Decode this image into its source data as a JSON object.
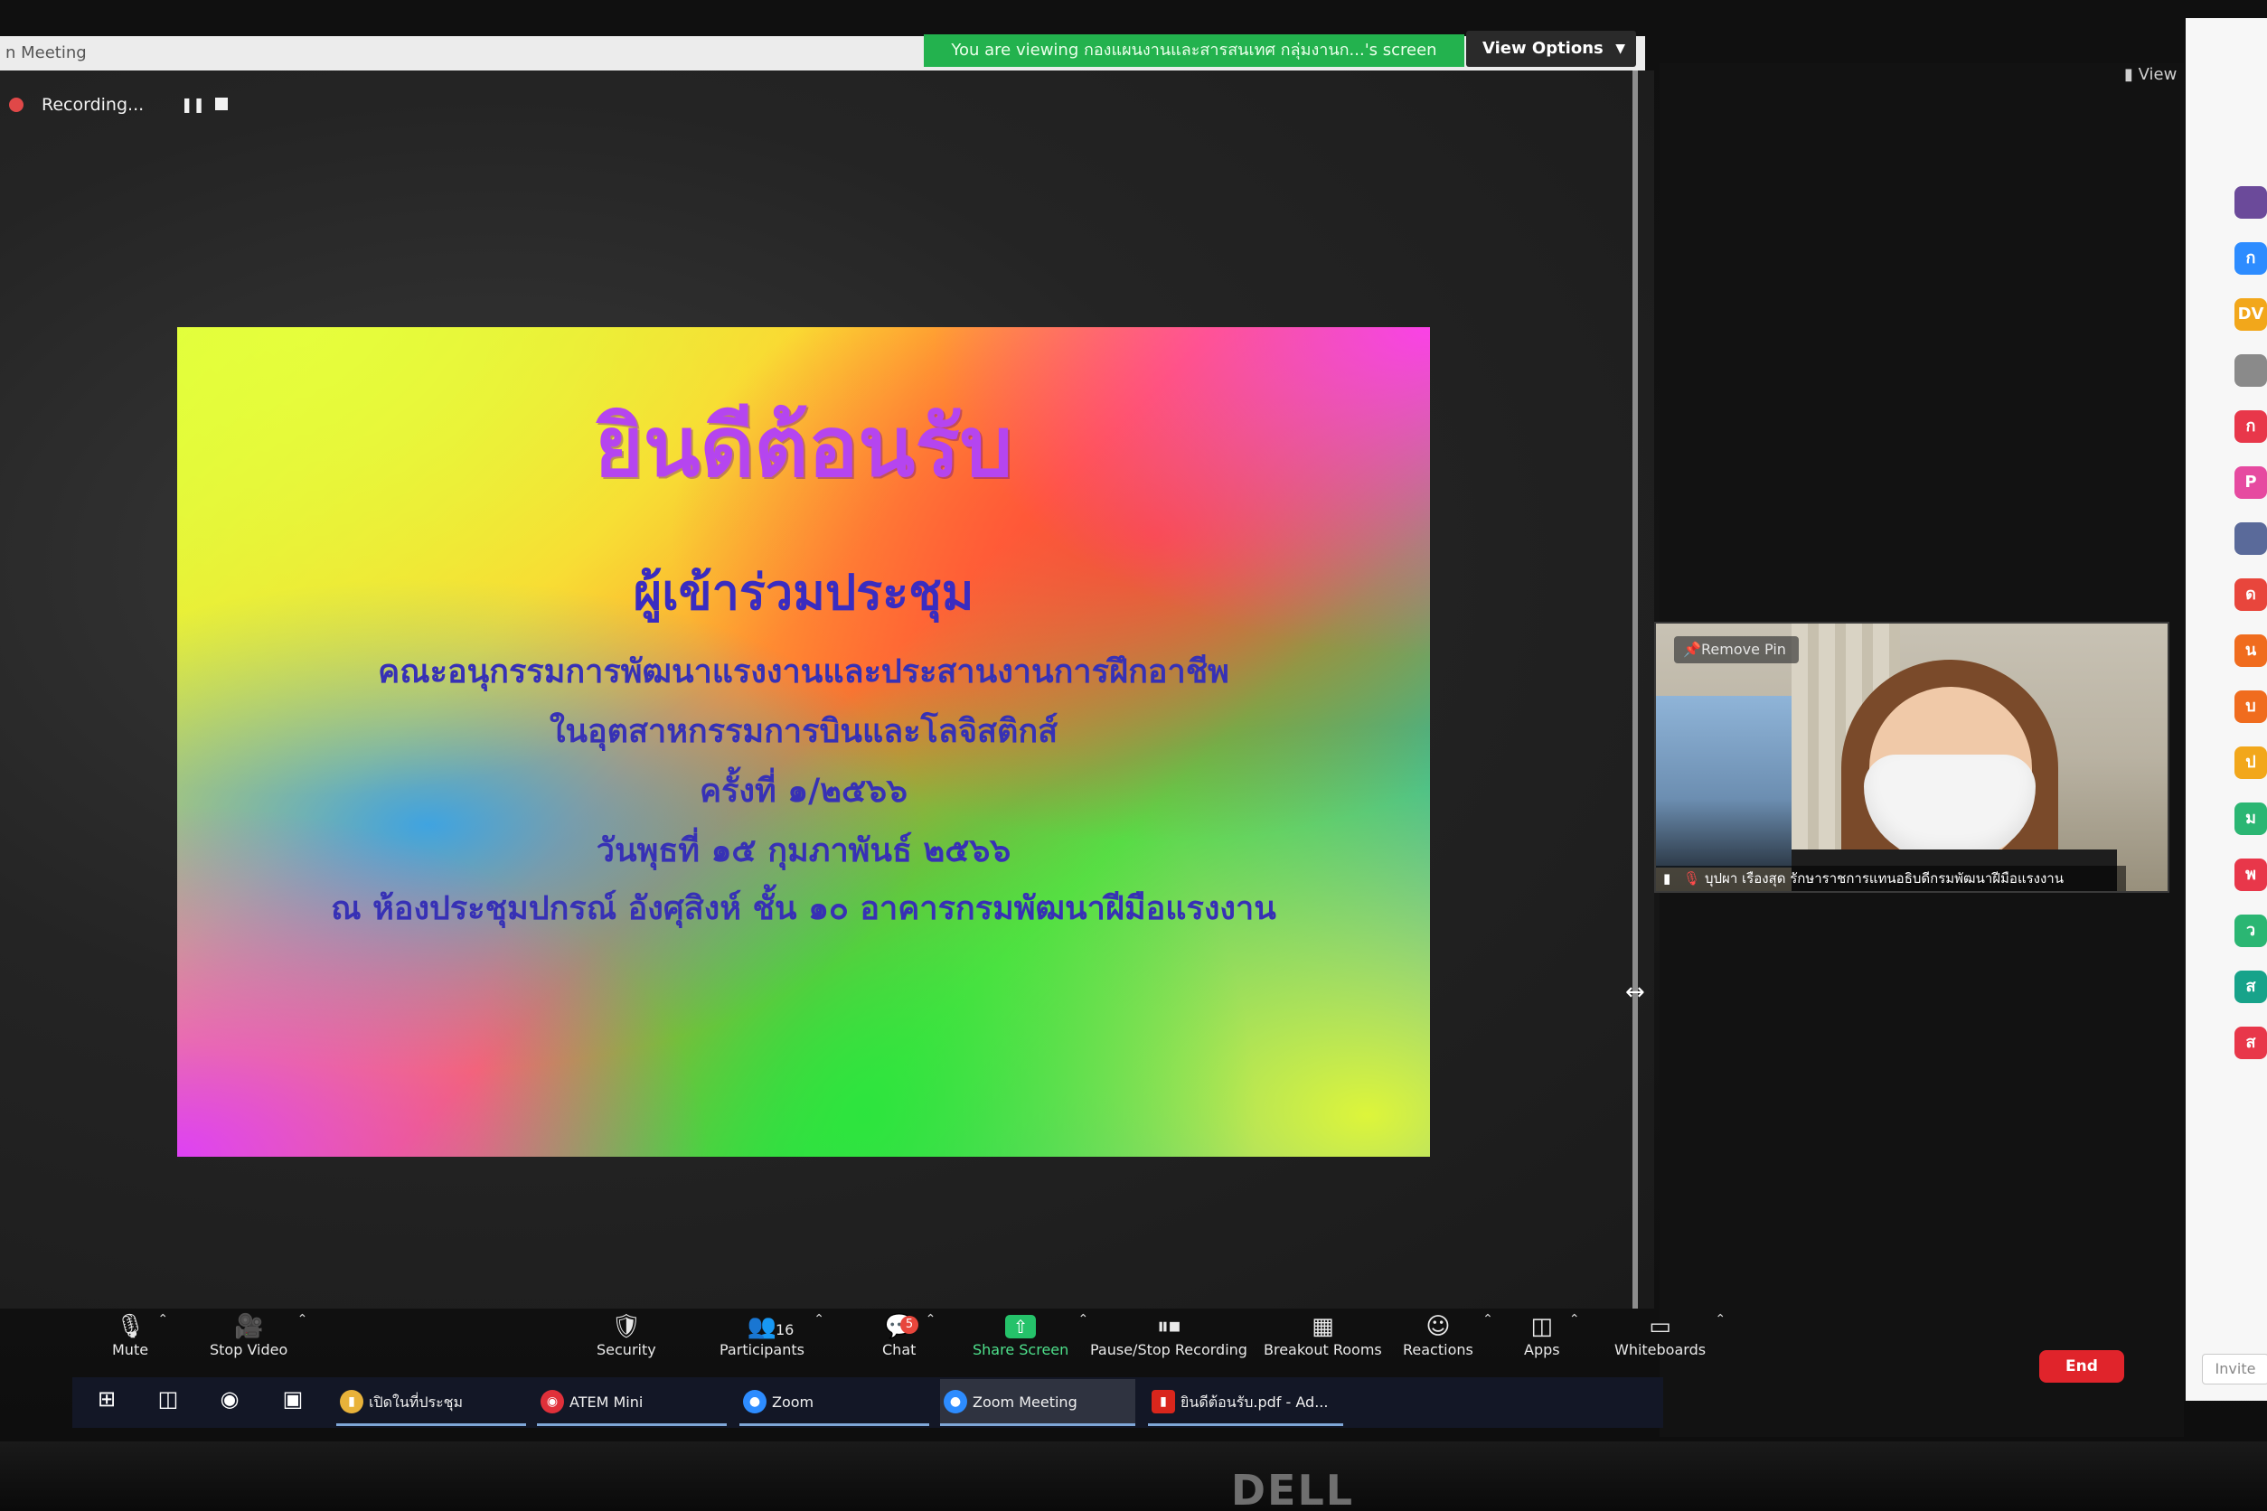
{
  "window": {
    "title_fragment": "n Meeting",
    "viewing_banner": "You are viewing กองแผนงานและสารสนเทศ กลุ่มงานก...'s screen",
    "view_options": "View Options"
  },
  "recording": {
    "label": "Recording...",
    "pause_icon": "pause-icon",
    "stop_icon": "stop-icon"
  },
  "slide": {
    "title": "ยินดีต้อนรับ",
    "subtitle": "ผู้เข้าร่วมประชุม",
    "lines": [
      "คณะอนุกรรมการพัฒนาแรงงานและประสานงานการฝึกอาชีพ",
      "ในอุตสาหกรรมการบินและโลจิสติกส์",
      "ครั้งที่ ๑/๒๕๖๖",
      "วันพุธที่ ๑๕ กุมภาพันธ์ ๒๕๖๖",
      "ณ ห้องประชุมปกรณ์ อังศุสิงห์ ชั้น ๑๐ อาคารกรมพัฒนาฝีมือแรงงาน"
    ],
    "colors": {
      "title": "#b545ef",
      "text": "#3731b5"
    }
  },
  "video": {
    "view_label": "View",
    "remove_pin": "Remove Pin",
    "participant_name": "บุปผา เรืองสุด รักษาราชการแทนอธิบดีกรมพัฒนาฝีมือแรงงาน"
  },
  "participants_panel": {
    "avatars": [
      {
        "letter": "",
        "color": "#6b4a9a"
      },
      {
        "letter": "ก",
        "color": "#2d8cff"
      },
      {
        "letter": "DV",
        "color": "#f2a71b"
      },
      {
        "letter": "",
        "color": "#8a8a8a"
      },
      {
        "letter": "ก",
        "color": "#e8374a"
      },
      {
        "letter": "P",
        "color": "#e64aa0"
      },
      {
        "letter": "",
        "color": "#5a6a9a"
      },
      {
        "letter": "ด",
        "color": "#e8463c"
      },
      {
        "letter": "น",
        "color": "#f06c1e"
      },
      {
        "letter": "บ",
        "color": "#f06c1e"
      },
      {
        "letter": "ป",
        "color": "#f2a71b"
      },
      {
        "letter": "ม",
        "color": "#2bb673"
      },
      {
        "letter": "พ",
        "color": "#e8374a"
      },
      {
        "letter": "ว",
        "color": "#2bb673"
      },
      {
        "letter": "ส",
        "color": "#17a38a"
      },
      {
        "letter": "ส",
        "color": "#e8374a"
      }
    ],
    "invite": "Invite"
  },
  "toolbar": {
    "mute": "Mute",
    "stop_video": "Stop Video",
    "security": "Security",
    "participants": "Participants",
    "participants_count": "16",
    "chat": "Chat",
    "chat_badge": "5",
    "share_screen": "Share Screen",
    "pause_stop_recording": "Pause/Stop Recording",
    "breakout_rooms": "Breakout Rooms",
    "reactions": "Reactions",
    "apps": "Apps",
    "whiteboards": "Whiteboards",
    "end": "End"
  },
  "taskbar": {
    "apps": [
      {
        "label": "เปิดในที่ประชุม",
        "icon": "folder-icon"
      },
      {
        "label": "ATEM Mini",
        "icon": "atem-icon"
      },
      {
        "label": "Zoom",
        "icon": "zoom-icon"
      },
      {
        "label": "Zoom Meeting",
        "icon": "zoom-icon"
      },
      {
        "label": "ยินดีต้อนรับ.pdf - Ad...",
        "icon": "pdf-icon"
      }
    ]
  },
  "monitor": {
    "brand": "DELL"
  }
}
